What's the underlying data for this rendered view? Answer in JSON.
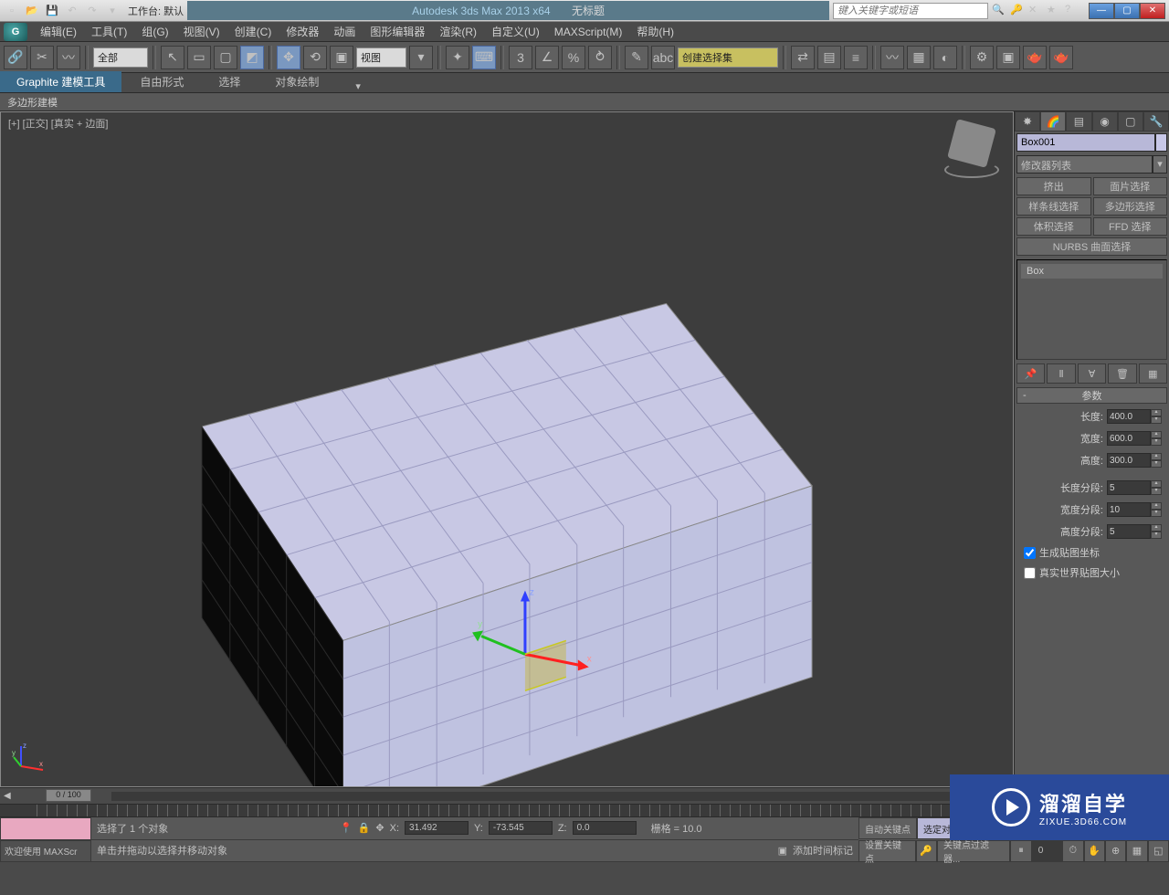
{
  "titlebar": {
    "workspace_label": "工作台: 默认",
    "app_title": "Autodesk 3ds Max  2013 x64",
    "doc_title": "无标题",
    "search_placeholder": "键入关键字或短语"
  },
  "menus": [
    "编辑(E)",
    "工具(T)",
    "组(G)",
    "视图(V)",
    "创建(C)",
    "修改器",
    "动画",
    "图形编辑器",
    "渲染(R)",
    "自定义(U)",
    "MAXScript(M)",
    "帮助(H)"
  ],
  "toolbar": {
    "filter_dd": "全部",
    "refcoord_dd": "视图",
    "named_sel_dd": "创建选择集"
  },
  "ribbon": {
    "tabs": [
      "Graphite 建模工具",
      "自由形式",
      "选择",
      "对象绘制"
    ],
    "sub": "多边形建模"
  },
  "viewport": {
    "label": "[+] [正交] [真实 + 边面]"
  },
  "cmd": {
    "object_name": "Box001",
    "modifier_dd": "修改器列表",
    "mod_buttons": [
      "挤出",
      "面片选择",
      "样条线选择",
      "多边形选择",
      "体积选择",
      "FFD 选择",
      "NURBS 曲面选择"
    ],
    "stack_item": "Box",
    "rollout_title": "参数",
    "params": {
      "length_label": "长度:",
      "length_val": "400.0",
      "width_label": "宽度:",
      "width_val": "600.0",
      "height_label": "高度:",
      "height_val": "300.0",
      "lsegs_label": "长度分段:",
      "lsegs_val": "5",
      "wsegs_label": "宽度分段:",
      "wsegs_val": "10",
      "hsegs_label": "高度分段:",
      "hsegs_val": "5",
      "gen_map": "生成贴图坐标",
      "real_world": "真实世界贴图大小"
    }
  },
  "timeline": {
    "frame": "0 / 100"
  },
  "status": {
    "script_line1": "欢迎使用  MAXScr",
    "sel_text": "选择了 1 个对象",
    "prompt_text": "单击并拖动以选择并移动对象",
    "x_label": "X:",
    "x_val": "31.492",
    "y_label": "Y:",
    "y_val": "-73.545",
    "z_label": "Z:",
    "z_val": "0.0",
    "grid": "栅格 = 10.0",
    "add_time_tag": "添加时间标记",
    "auto_key": "自动关键点",
    "set_key": "设置关键点",
    "sel_obj": "选定对",
    "key_filter": "关键点过滤器..."
  },
  "watermark": {
    "big": "溜溜自学",
    "small": "ZIXUE.3D66.COM"
  }
}
